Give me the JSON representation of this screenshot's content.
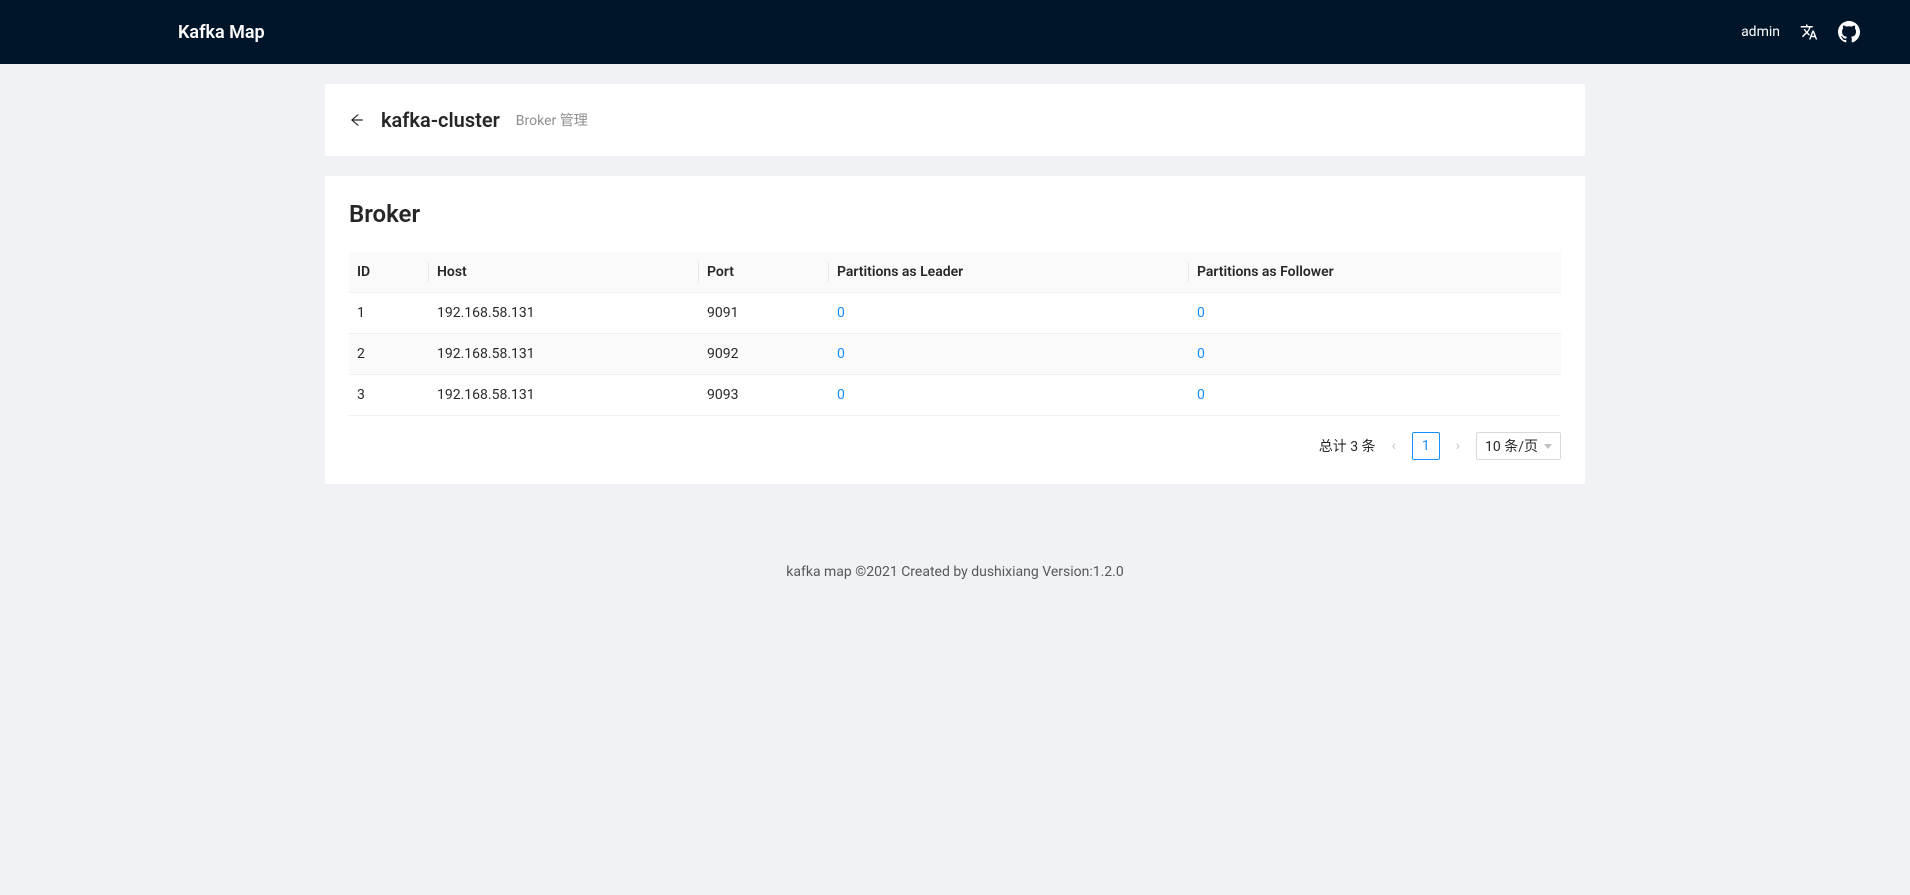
{
  "header": {
    "app_title": "Kafka Map",
    "username": "admin"
  },
  "breadcrumb": {
    "cluster_name": "kafka-cluster",
    "sub": "Broker 管理"
  },
  "section": {
    "title": "Broker"
  },
  "table": {
    "columns": [
      "ID",
      "Host",
      "Port",
      "Partitions as Leader",
      "Partitions as Follower"
    ],
    "rows": [
      {
        "id": "1",
        "host": "192.168.58.131",
        "port": "9091",
        "leader": "0",
        "follower": "0"
      },
      {
        "id": "2",
        "host": "192.168.58.131",
        "port": "9092",
        "leader": "0",
        "follower": "0"
      },
      {
        "id": "3",
        "host": "192.168.58.131",
        "port": "9093",
        "leader": "0",
        "follower": "0"
      }
    ]
  },
  "pagination": {
    "total_text": "总计 3 条",
    "current_page": "1",
    "page_size_label": "10 条/页"
  },
  "footer": {
    "text": "kafka map ©2021 Created by dushixiang Version:1.2.0"
  }
}
